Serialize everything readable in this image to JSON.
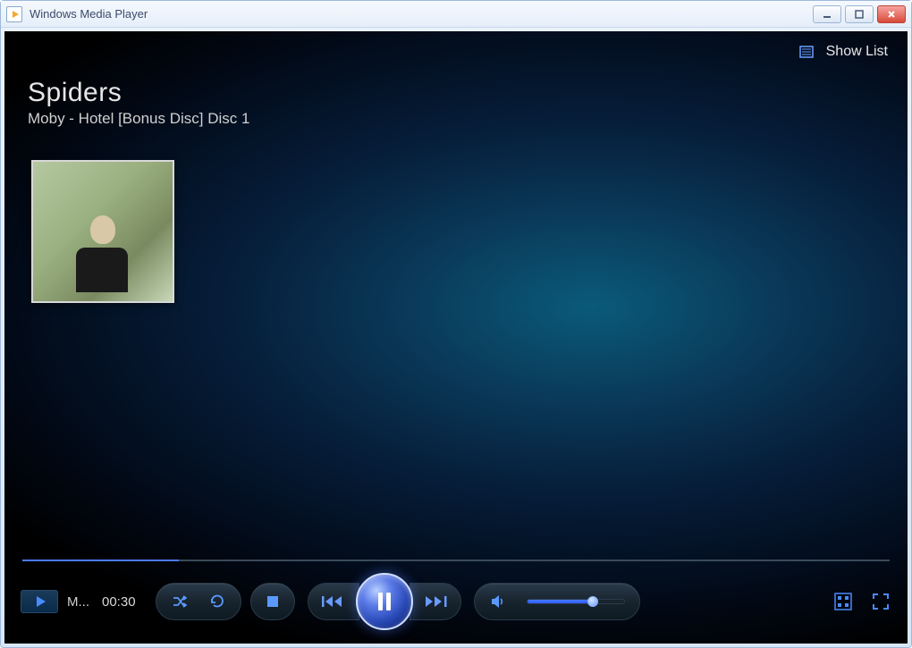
{
  "window": {
    "title": "Windows Media Player"
  },
  "header": {
    "show_list_label": "Show List"
  },
  "now_playing": {
    "track_title": "Spiders",
    "artist_album": "Moby - Hotel [Bonus Disc] Disc 1",
    "thumb_label": "M...",
    "elapsed_time": "00:30"
  },
  "seek": {
    "percent": 18
  },
  "volume": {
    "percent": 68
  },
  "icons": {
    "list": "list-icon",
    "shuffle": "shuffle-icon",
    "repeat": "repeat-icon",
    "stop": "stop-icon",
    "prev": "previous-icon",
    "pause": "pause-icon",
    "next": "next-icon",
    "mute": "volume-icon",
    "library": "library-icon",
    "fullscreen": "fullscreen-icon"
  }
}
